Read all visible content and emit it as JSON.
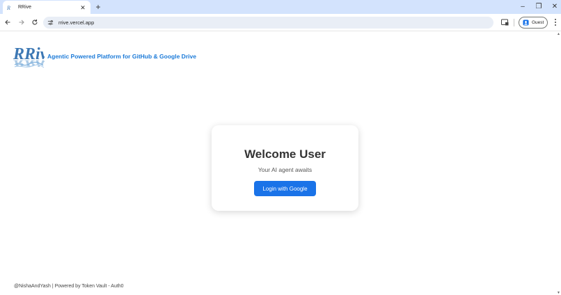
{
  "browser": {
    "tab_title": "RRive",
    "tab_close": "✕",
    "new_tab": "+",
    "url": "rrive.vercel.app",
    "profile_label": "Guest",
    "window_controls": [
      "–",
      "❐",
      "✕"
    ]
  },
  "header": {
    "logo_text": "RRive",
    "tagline": "Agentic Powered Platform for GitHub & Google Drive"
  },
  "card": {
    "title": "Welcome User",
    "subtitle": "Your AI agent awaits",
    "login_label": "Login with Google"
  },
  "footer": {
    "text": "@NishaAndYash | Powered by Token Vault - Auth0"
  },
  "colors": {
    "accent": "#1a73e8",
    "tagline": "#1b7ad8",
    "tabstrip": "#d3e3fd"
  }
}
